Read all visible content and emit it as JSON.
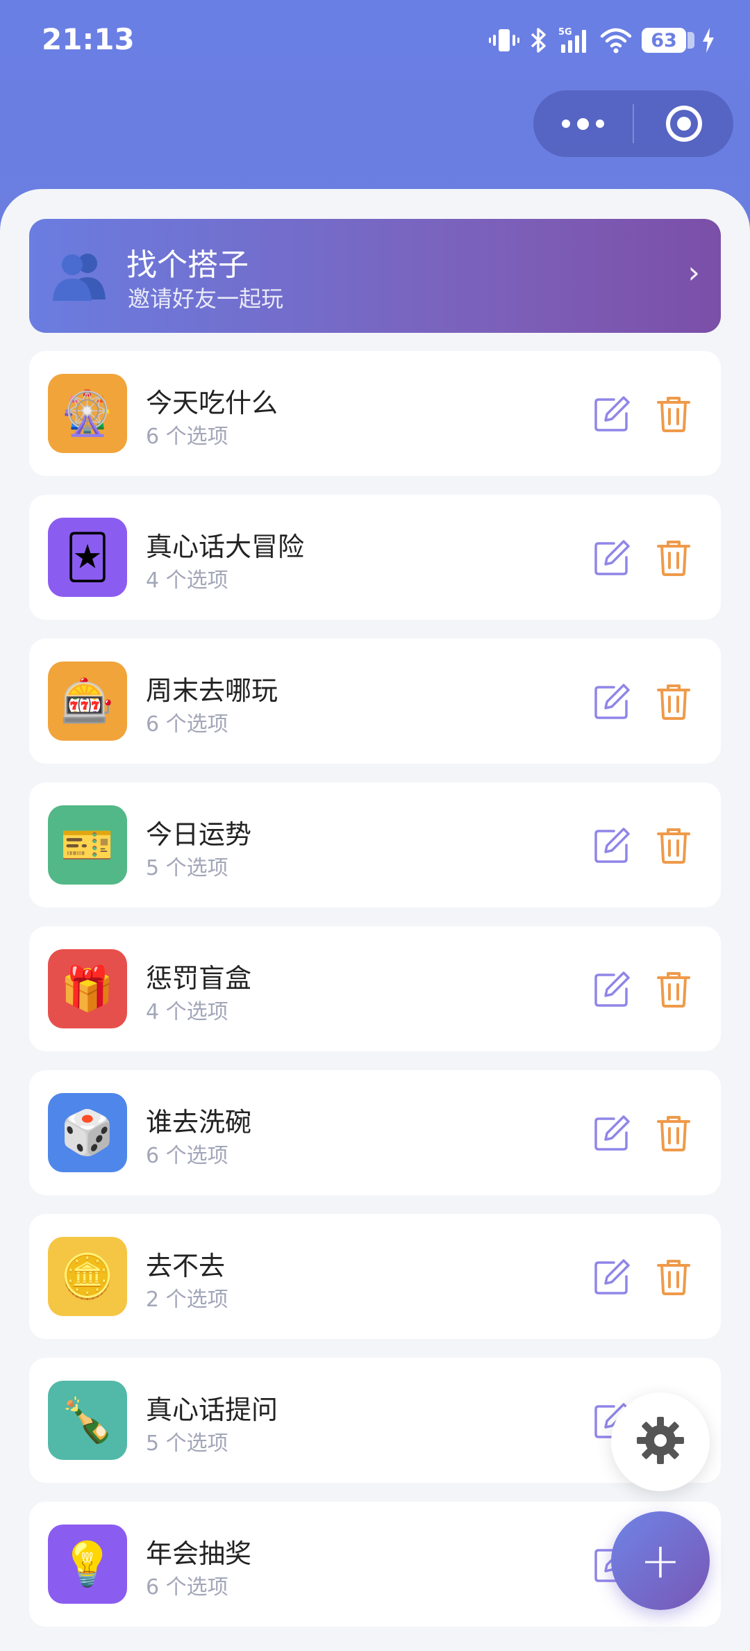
{
  "status_bar": {
    "time": "21:13",
    "battery": "63",
    "network": "5G",
    "icons": [
      "vibrate-icon",
      "bluetooth-icon",
      "signal-icon",
      "wifi-icon",
      "battery-icon",
      "charging-icon"
    ]
  },
  "capsule": {
    "icons": [
      "more-icon",
      "close-miniprogram-icon"
    ]
  },
  "banner": {
    "title": "找个搭子",
    "subtitle": "邀请好友一起玩",
    "chevron": "›",
    "icon": "people-icon"
  },
  "items": [
    {
      "title": "今天吃什么",
      "count": "6 个选项",
      "emoji": "🎡",
      "color": "#f0a43a"
    },
    {
      "title": "真心话大冒险",
      "count": "4 个选项",
      "emoji": "🃏",
      "color": "#8b5cf0"
    },
    {
      "title": "周末去哪玩",
      "count": "6 个选项",
      "emoji": "🎰",
      "color": "#f0a43a"
    },
    {
      "title": "今日运势",
      "count": "5 个选项",
      "emoji": "🎫",
      "color": "#52b887"
    },
    {
      "title": "惩罚盲盒",
      "count": "4 个选项",
      "emoji": "🎁",
      "color": "#e6504c"
    },
    {
      "title": "谁去洗碗",
      "count": "6 个选项",
      "emoji": "🎲",
      "color": "#4f86ea"
    },
    {
      "title": "去不去",
      "count": "2 个选项",
      "emoji": "🪙",
      "color": "#f5c544"
    },
    {
      "title": "真心话提问",
      "count": "5 个选项",
      "emoji": "🍾",
      "color": "#52b8a8"
    },
    {
      "title": "年会抽奖",
      "count": "6 个选项",
      "emoji": "💡",
      "color": "#8b5cf0"
    }
  ],
  "actions": {
    "edit_icon": "edit-icon",
    "delete_icon": "trash-icon",
    "edit_color": "#8f86e8",
    "delete_color": "#ef9a4a"
  },
  "fab": {
    "settings_icon": "gear-icon",
    "add_label": "+"
  }
}
